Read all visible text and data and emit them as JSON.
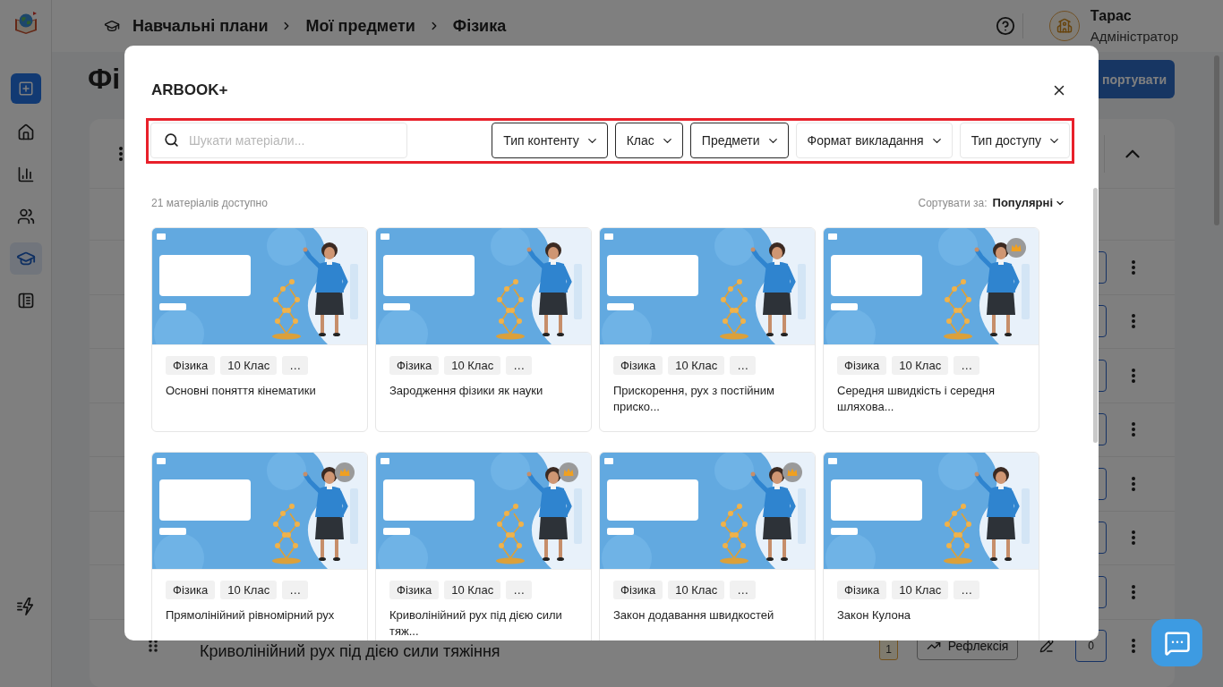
{
  "sidebar": {
    "nav_items": [
      {
        "selected": false
      },
      {
        "selected": false
      },
      {
        "selected": false
      },
      {
        "selected": true
      },
      {
        "selected": false
      }
    ]
  },
  "header": {
    "breadcrumbs": [
      "Навчальні плани",
      "Мої предмети",
      "Фізика"
    ],
    "user": {
      "name": "Тарас",
      "role": "Адміністратор"
    }
  },
  "page": {
    "title": "Фі",
    "import_button": "портувати",
    "card": {
      "expanded": true
    },
    "rows": [
      {
        "kind": "covered"
      },
      {
        "kind": "covered"
      },
      {
        "kind": "covered"
      },
      {
        "kind": "covered"
      },
      {
        "kind": "covered"
      },
      {
        "kind": "covered"
      },
      {
        "kind": "covered"
      },
      {
        "kind": "visible",
        "title": "Криволінійний рух під дією сили тяжіння",
        "badge": "1",
        "action": "Рефлексія",
        "counter": "0"
      }
    ]
  },
  "dialog": {
    "title": "ARBOOK+",
    "filter_bar": {
      "highlighted": true
    },
    "search": {
      "placeholder": "Шукати матеріали..."
    },
    "filters": [
      {
        "label": "Тип контенту",
        "active": true
      },
      {
        "label": "Клас",
        "active": true
      },
      {
        "label": "Предмети",
        "active": true
      },
      {
        "label": "Формат викладання",
        "active": false
      },
      {
        "label": "Тип доступу",
        "active": false
      }
    ],
    "count": "21 матеріалів доступно",
    "sort": {
      "label": "Сортувати за:",
      "value": "Популярні"
    },
    "materials": [
      {
        "title": "Основні поняття кінематики",
        "tags": [
          "Фізика",
          "10 Клас",
          "…"
        ],
        "premium": false
      },
      {
        "title": "Зародження фізики як науки",
        "tags": [
          "Фізика",
          "10 Клас",
          "…"
        ],
        "premium": false
      },
      {
        "title": "Прискорення, рух з постійним приско...",
        "tags": [
          "Фізика",
          "10 Клас",
          "…"
        ],
        "premium": false
      },
      {
        "title": "Середня швидкість і середня шляхова...",
        "tags": [
          "Фізика",
          "10 Клас",
          "…"
        ],
        "premium": true
      },
      {
        "title": "Прямолінійний рівномірний рух",
        "tags": [
          "Фізика",
          "10 Клас",
          "…"
        ],
        "premium": true
      },
      {
        "title": "Криволінійний рух під дією сили тяж...",
        "tags": [
          "Фізика",
          "10 Клас",
          "…"
        ],
        "premium": true
      },
      {
        "title": "Закон додавання швидкостей",
        "tags": [
          "Фізика",
          "10 Клас",
          "…"
        ],
        "premium": true
      },
      {
        "title": "Закон Кулона",
        "tags": [
          "Фізика",
          "10 Клас",
          "…"
        ],
        "premium": false
      }
    ]
  }
}
